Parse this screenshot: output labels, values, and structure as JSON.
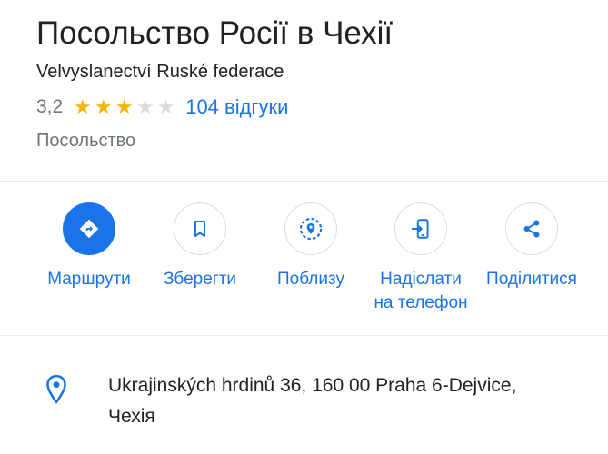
{
  "place": {
    "title": "Посольство Росії в Чехії",
    "subtitle": "Velvyslanectví Ruské federace",
    "rating": "3,2",
    "rating_stars": 3,
    "reviews_link": "104 відгуки",
    "category": "Посольство"
  },
  "actions": [
    {
      "label": "Маршрути",
      "icon": "directions-icon",
      "primary": true
    },
    {
      "label": "Зберегти",
      "icon": "bookmark-icon",
      "primary": false
    },
    {
      "label": "Поблизу",
      "icon": "nearby-icon",
      "primary": false
    },
    {
      "label": "Надіслати на телефон",
      "label_line1": "Надіслати",
      "label_line2": "на телефон",
      "icon": "send-to-phone-icon",
      "primary": false
    },
    {
      "label": "Поділитися",
      "icon": "share-icon",
      "primary": false
    }
  ],
  "address": {
    "line1": "Ukrajinských hrdinů 36, 160 00 Praha 6-Dejvice,",
    "line2": "Чехія",
    "icon": "location-pin-icon"
  },
  "colors": {
    "accent": "#1a73e8",
    "star_filled": "#f4b400",
    "star_empty": "#dadce0",
    "secondary_text": "#70757a"
  }
}
